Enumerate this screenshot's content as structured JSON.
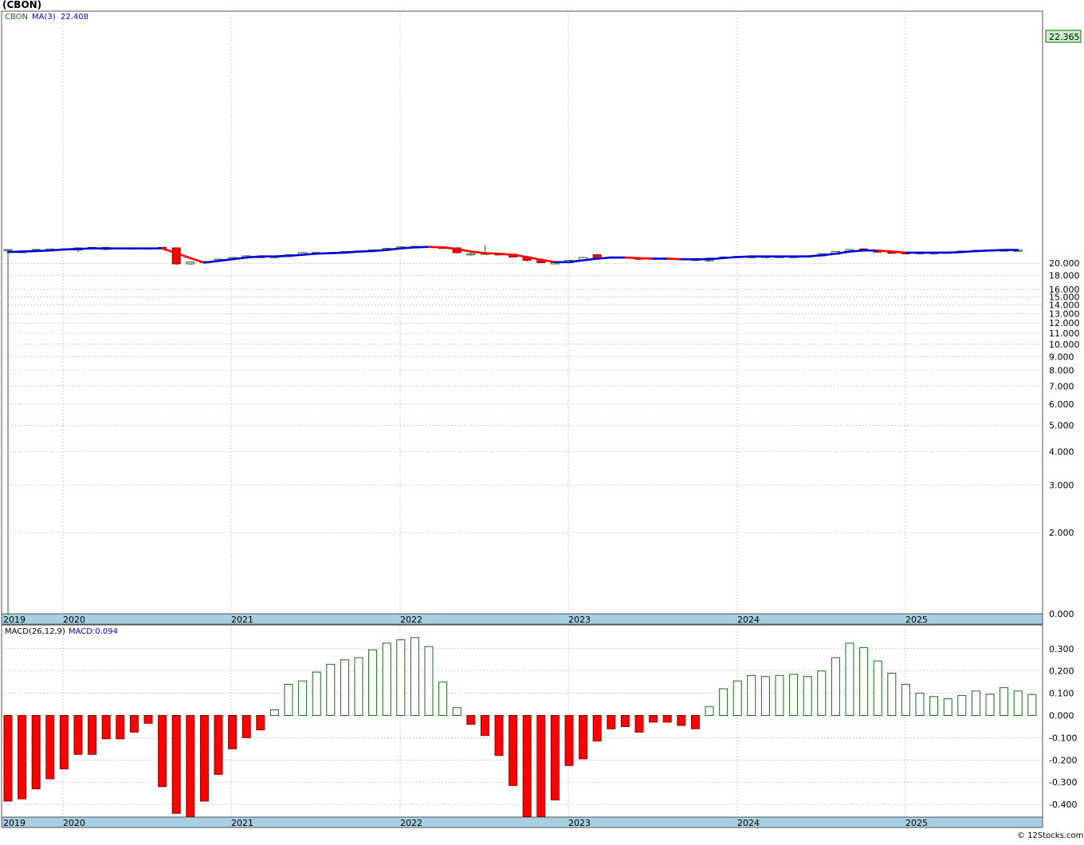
{
  "page": {
    "title": "(CBON)",
    "copyright": "© 12Stocks.com"
  },
  "price_panel": {
    "symbol_label": "CBON",
    "ma_label": "MA(3)",
    "ma_value": "22.408",
    "last_price": "22.365",
    "y_ticks": [
      "20.000",
      "18.000",
      "16.000",
      "15.000",
      "14.000",
      "13.000",
      "12.000",
      "11.000",
      "10.000",
      "9.000",
      "8.000",
      "7.000",
      "6.000",
      "5.000",
      "4.000",
      "3.000",
      "2.000",
      "0.000"
    ],
    "year_labels": [
      "2019",
      "2020",
      "2021",
      "2022",
      "2023",
      "2024",
      "2025"
    ]
  },
  "macd_panel": {
    "params_label": "MACD(26,12,9)",
    "value_label": "MACD:0.094",
    "y_ticks": [
      "0.300",
      "0.200",
      "0.100",
      "0.000",
      "-0.100",
      "-0.200",
      "-0.300",
      "-0.400"
    ],
    "year_labels": [
      "2019",
      "2020",
      "2021",
      "2022",
      "2023",
      "2024",
      "2025"
    ]
  },
  "colors": {
    "up": "#1a6b1a",
    "down": "#ff0000",
    "ma_up": "#0000dd",
    "ma_down": "#ff0000",
    "axis_band": "#a6cfe0",
    "grid": "#b0b0b0",
    "last_price_box": "#c8f0c8"
  },
  "chart_data": [
    {
      "type": "candlestick",
      "title": "(CBON)",
      "scale": "log",
      "frequency": "monthly",
      "x_start": "2019-03",
      "candles": [
        {
          "o": 22.4,
          "h": 22.6,
          "l": 0.0,
          "c": 22.5
        },
        {
          "o": 21.9,
          "h": 22.3,
          "l": 21.8,
          "c": 22.2
        },
        {
          "o": 22.2,
          "h": 22.6,
          "l": 22.1,
          "c": 22.5
        },
        {
          "o": 22.5,
          "h": 22.7,
          "l": 22.4,
          "c": 22.6
        },
        {
          "o": 22.4,
          "h": 22.7,
          "l": 22.3,
          "c": 22.6
        },
        {
          "o": 22.4,
          "h": 22.9,
          "l": 22.0,
          "c": 22.8
        },
        {
          "o": 22.9,
          "h": 23.0,
          "l": 22.5,
          "c": 22.7
        },
        {
          "o": 22.5,
          "h": 23.0,
          "l": 22.4,
          "c": 22.9
        },
        {
          "o": 22.8,
          "h": 22.9,
          "l": 22.5,
          "c": 22.6
        },
        {
          "o": 22.8,
          "h": 22.9,
          "l": 22.5,
          "c": 22.6
        },
        {
          "o": 22.8,
          "h": 22.9,
          "l": 22.5,
          "c": 22.7
        },
        {
          "o": 22.9,
          "h": 22.9,
          "l": 22.6,
          "c": 22.7
        },
        {
          "o": 22.8,
          "h": 22.9,
          "l": 19.7,
          "c": 19.9
        },
        {
          "o": 19.9,
          "h": 20.3,
          "l": 19.7,
          "c": 20.2
        },
        {
          "o": 20.2,
          "h": 20.4,
          "l": 20.1,
          "c": 20.3
        },
        {
          "o": 20.4,
          "h": 20.8,
          "l": 20.3,
          "c": 20.7
        },
        {
          "o": 20.7,
          "h": 21.1,
          "l": 20.6,
          "c": 21.0
        },
        {
          "o": 21.0,
          "h": 21.4,
          "l": 20.9,
          "c": 21.3
        },
        {
          "o": 21.2,
          "h": 21.3,
          "l": 20.9,
          "c": 21.1
        },
        {
          "o": 21.0,
          "h": 21.3,
          "l": 20.9,
          "c": 21.2
        },
        {
          "o": 21.2,
          "h": 21.6,
          "l": 21.1,
          "c": 21.5
        },
        {
          "o": 21.5,
          "h": 22.0,
          "l": 21.4,
          "c": 21.9
        },
        {
          "o": 21.9,
          "h": 22.0,
          "l": 21.6,
          "c": 21.7
        },
        {
          "o": 21.7,
          "h": 22.0,
          "l": 21.6,
          "c": 21.9
        },
        {
          "o": 21.8,
          "h": 22.2,
          "l": 21.7,
          "c": 22.1
        },
        {
          "o": 22.0,
          "h": 22.3,
          "l": 21.9,
          "c": 22.2
        },
        {
          "o": 22.2,
          "h": 22.5,
          "l": 22.1,
          "c": 22.4
        },
        {
          "o": 22.4,
          "h": 22.8,
          "l": 22.3,
          "c": 22.7
        },
        {
          "o": 22.7,
          "h": 23.1,
          "l": 22.6,
          "c": 23.0
        },
        {
          "o": 22.9,
          "h": 23.2,
          "l": 22.8,
          "c": 23.1
        },
        {
          "o": 23.1,
          "h": 23.2,
          "l": 22.9,
          "c": 23.0
        },
        {
          "o": 23.0,
          "h": 23.1,
          "l": 22.6,
          "c": 22.7
        },
        {
          "o": 22.8,
          "h": 22.9,
          "l": 21.8,
          "c": 21.9
        },
        {
          "o": 21.6,
          "h": 21.9,
          "l": 21.3,
          "c": 21.7
        },
        {
          "o": 21.8,
          "h": 23.4,
          "l": 21.7,
          "c": 21.8
        },
        {
          "o": 21.7,
          "h": 21.9,
          "l": 21.5,
          "c": 21.6
        },
        {
          "o": 21.6,
          "h": 21.7,
          "l": 21.0,
          "c": 21.1
        },
        {
          "o": 21.1,
          "h": 21.2,
          "l": 20.3,
          "c": 20.5
        },
        {
          "o": 20.6,
          "h": 20.7,
          "l": 20.0,
          "c": 20.1
        },
        {
          "o": 20.0,
          "h": 20.2,
          "l": 19.8,
          "c": 20.1
        },
        {
          "o": 20.1,
          "h": 20.6,
          "l": 20.0,
          "c": 20.5
        },
        {
          "o": 20.5,
          "h": 21.1,
          "l": 20.4,
          "c": 21.0
        },
        {
          "o": 21.5,
          "h": 21.6,
          "l": 20.7,
          "c": 20.9
        },
        {
          "o": 21.0,
          "h": 21.2,
          "l": 20.8,
          "c": 21.1
        },
        {
          "o": 21.1,
          "h": 21.2,
          "l": 20.8,
          "c": 20.9
        },
        {
          "o": 20.9,
          "h": 21.0,
          "l": 20.6,
          "c": 20.7
        },
        {
          "o": 20.8,
          "h": 21.0,
          "l": 20.6,
          "c": 20.9
        },
        {
          "o": 20.9,
          "h": 21.0,
          "l": 20.6,
          "c": 20.7
        },
        {
          "o": 20.8,
          "h": 20.9,
          "l": 20.6,
          "c": 20.7
        },
        {
          "o": 20.7,
          "h": 20.8,
          "l": 20.4,
          "c": 20.6
        },
        {
          "o": 20.4,
          "h": 21.0,
          "l": 20.3,
          "c": 20.9
        },
        {
          "o": 20.9,
          "h": 21.2,
          "l": 20.8,
          "c": 21.1
        },
        {
          "o": 21.0,
          "h": 21.3,
          "l": 20.9,
          "c": 21.2
        },
        {
          "o": 21.2,
          "h": 21.4,
          "l": 21.0,
          "c": 21.1
        },
        {
          "o": 21.1,
          "h": 21.3,
          "l": 21.0,
          "c": 21.2
        },
        {
          "o": 21.1,
          "h": 21.3,
          "l": 21.0,
          "c": 21.2
        },
        {
          "o": 21.1,
          "h": 21.3,
          "l": 21.0,
          "c": 21.2
        },
        {
          "o": 21.2,
          "h": 21.4,
          "l": 21.1,
          "c": 21.3
        },
        {
          "o": 21.3,
          "h": 21.8,
          "l": 21.2,
          "c": 21.7
        },
        {
          "o": 21.6,
          "h": 22.2,
          "l": 21.5,
          "c": 22.1
        },
        {
          "o": 22.1,
          "h": 22.6,
          "l": 22.0,
          "c": 22.5
        },
        {
          "o": 22.6,
          "h": 22.7,
          "l": 22.3,
          "c": 22.4
        },
        {
          "o": 22.3,
          "h": 22.4,
          "l": 21.9,
          "c": 22.0
        },
        {
          "o": 22.0,
          "h": 22.2,
          "l": 21.8,
          "c": 21.9
        },
        {
          "o": 21.9,
          "h": 22.1,
          "l": 21.7,
          "c": 21.8
        },
        {
          "o": 21.8,
          "h": 22.0,
          "l": 21.7,
          "c": 21.9
        },
        {
          "o": 21.8,
          "h": 22.0,
          "l": 21.5,
          "c": 21.9
        },
        {
          "o": 21.9,
          "h": 22.1,
          "l": 21.8,
          "c": 22.0
        },
        {
          "o": 22.0,
          "h": 22.3,
          "l": 21.9,
          "c": 22.2
        },
        {
          "o": 22.2,
          "h": 22.5,
          "l": 22.1,
          "c": 22.3
        },
        {
          "o": 22.3,
          "h": 22.6,
          "l": 22.2,
          "c": 22.4
        },
        {
          "o": 22.3,
          "h": 22.6,
          "l": 22.2,
          "c": 22.4
        },
        {
          "o": 22.3,
          "h": 22.5,
          "l": 22.2,
          "c": 22.365
        }
      ],
      "ma3": [
        22.0,
        22.1,
        22.2,
        22.3,
        22.5,
        22.6,
        22.7,
        22.7,
        22.7,
        22.7,
        22.7,
        22.7,
        21.8,
        20.9,
        20.1,
        20.4,
        20.7,
        21.0,
        21.2,
        21.2,
        21.3,
        21.5,
        21.7,
        21.8,
        21.9,
        22.1,
        22.2,
        22.4,
        22.7,
        22.9,
        23.0,
        22.9,
        22.6,
        22.1,
        21.8,
        21.7,
        21.5,
        21.1,
        20.6,
        20.2,
        20.2,
        20.5,
        20.8,
        21.0,
        21.0,
        20.9,
        20.8,
        20.8,
        20.7,
        20.7,
        20.7,
        20.9,
        21.1,
        21.2,
        21.2,
        21.2,
        21.2,
        21.2,
        21.4,
        21.7,
        22.1,
        22.3,
        22.3,
        22.1,
        21.9,
        21.9,
        21.9,
        21.9,
        22.0,
        22.2,
        22.3,
        22.4,
        22.408
      ]
    },
    {
      "type": "bar",
      "title": "MACD(26,12,9)",
      "frequency": "monthly",
      "x_start": "2019-03",
      "values": [
        -0.385,
        -0.375,
        -0.33,
        -0.285,
        -0.24,
        -0.175,
        -0.175,
        -0.105,
        -0.105,
        -0.075,
        -0.035,
        -0.32,
        -0.44,
        -0.455,
        -0.385,
        -0.265,
        -0.15,
        -0.1,
        -0.065,
        0.025,
        0.14,
        0.155,
        0.195,
        0.23,
        0.25,
        0.26,
        0.295,
        0.325,
        0.34,
        0.35,
        0.31,
        0.15,
        0.035,
        -0.04,
        -0.09,
        -0.18,
        -0.315,
        -0.455,
        -0.455,
        -0.38,
        -0.225,
        -0.195,
        -0.115,
        -0.06,
        -0.05,
        -0.075,
        -0.03,
        -0.03,
        -0.045,
        -0.06,
        0.04,
        0.12,
        0.155,
        0.18,
        0.175,
        0.18,
        0.185,
        0.175,
        0.2,
        0.26,
        0.325,
        0.305,
        0.245,
        0.19,
        0.14,
        0.1,
        0.085,
        0.075,
        0.09,
        0.11,
        0.095,
        0.125,
        0.11,
        0.094
      ],
      "ylim": [
        -0.45,
        0.35
      ]
    }
  ]
}
